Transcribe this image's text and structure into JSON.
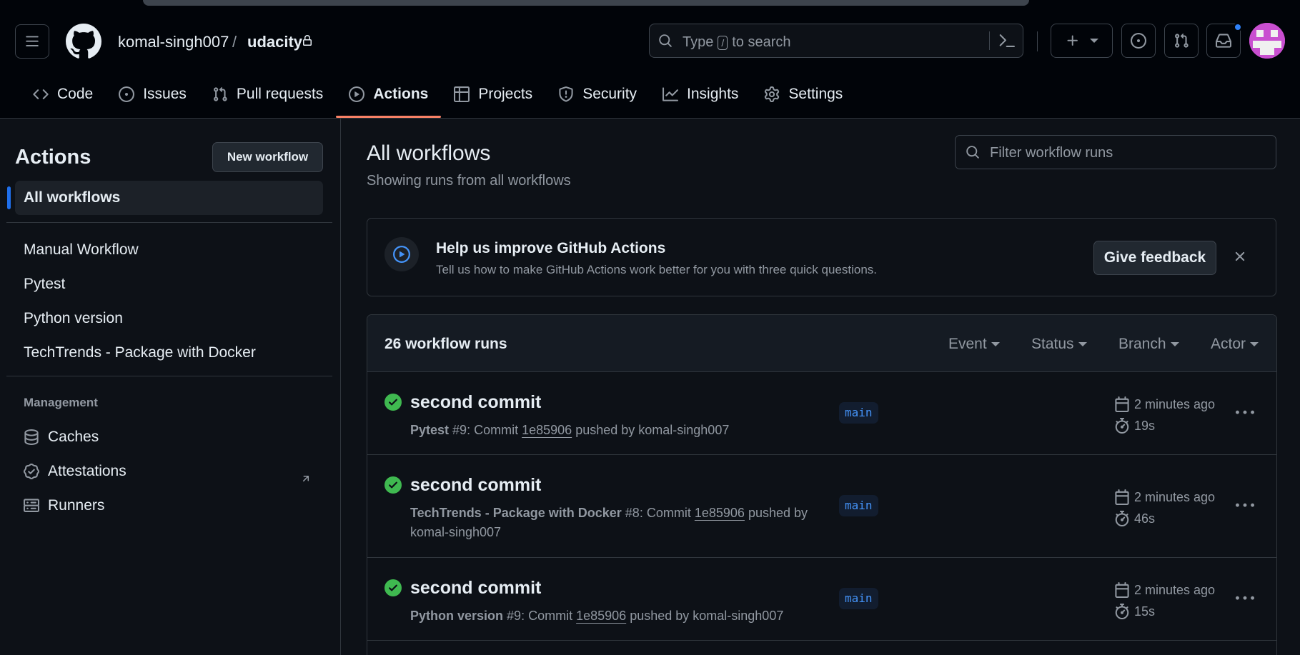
{
  "header": {
    "owner": "komal-singh007",
    "separator": "/",
    "repo": "udacity",
    "search_prefix": "Type",
    "search_key": "/",
    "search_suffix": "to search"
  },
  "repo_nav": [
    {
      "label": "Code",
      "icon": "code-icon"
    },
    {
      "label": "Issues",
      "icon": "issue-icon"
    },
    {
      "label": "Pull requests",
      "icon": "pull-request-icon"
    },
    {
      "label": "Actions",
      "icon": "play-icon",
      "active": true
    },
    {
      "label": "Projects",
      "icon": "table-icon"
    },
    {
      "label": "Security",
      "icon": "shield-icon"
    },
    {
      "label": "Insights",
      "icon": "graph-icon"
    },
    {
      "label": "Settings",
      "icon": "gear-icon"
    }
  ],
  "sidebar": {
    "title": "Actions",
    "new_workflow": "New workflow",
    "all_workflows": "All workflows",
    "workflows": [
      "Manual Workflow",
      "Pytest",
      "Python version",
      "TechTrends - Package with Docker"
    ],
    "management_title": "Management",
    "management": [
      {
        "label": "Caches",
        "icon": "database-icon"
      },
      {
        "label": "Attestations",
        "icon": "verified-icon"
      },
      {
        "label": "Runners",
        "icon": "server-icon"
      }
    ]
  },
  "main": {
    "title": "All workflows",
    "subtitle": "Showing runs from all workflows",
    "filter_placeholder": "Filter workflow runs"
  },
  "banner": {
    "title": "Help us improve GitHub Actions",
    "text": "Tell us how to make GitHub Actions work better for you with three quick questions.",
    "button": "Give feedback"
  },
  "runs": {
    "count_label": "26 workflow runs",
    "filters": [
      "Event",
      "Status",
      "Branch",
      "Actor"
    ],
    "items": [
      {
        "title": "second commit",
        "workflow": "Pytest",
        "number": "#9",
        "commit_label": "Commit",
        "sha": "1e85906",
        "pushed_by": "pushed by komal-singh007",
        "branch": "main",
        "time": "2 minutes ago",
        "duration": "19s",
        "status": "success"
      },
      {
        "title": "second commit",
        "workflow": "TechTrends - Package with Docker",
        "number": "#8",
        "commit_label": "Commit",
        "sha": "1e85906",
        "pushed_by": "pushed by komal-singh007",
        "branch": "main",
        "time": "2 minutes ago",
        "duration": "46s",
        "status": "success"
      },
      {
        "title": "second commit",
        "workflow": "Python version",
        "number": "#9",
        "commit_label": "Commit",
        "sha": "1e85906",
        "pushed_by": "pushed by komal-singh007",
        "branch": "main",
        "time": "2 minutes ago",
        "duration": "15s",
        "status": "success"
      }
    ]
  },
  "colors": {
    "background": "#0d1117",
    "header": "#010409",
    "accent_underline": "#f78166",
    "success": "#3fb950",
    "link_blue": "#4493f8",
    "selected_bar": "#1f6feb"
  }
}
